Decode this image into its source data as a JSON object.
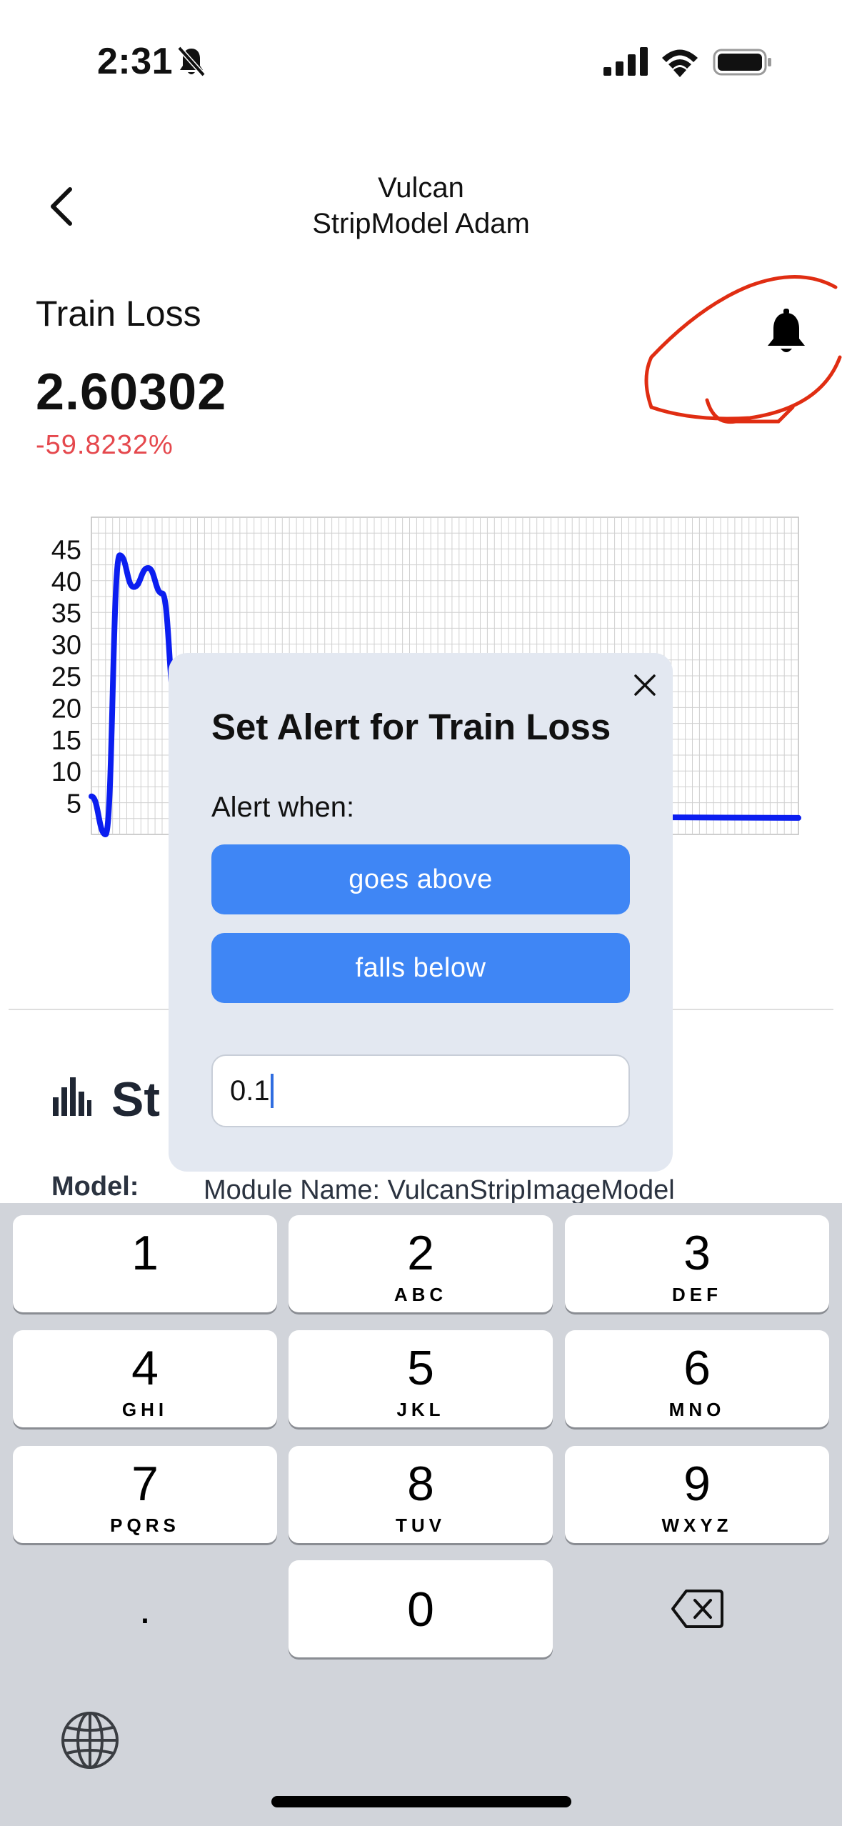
{
  "status_bar": {
    "time": "2:31"
  },
  "header": {
    "title_line1": "Vulcan",
    "title_line2": "StripModel Adam"
  },
  "metric": {
    "title": "Train Loss",
    "value": "2.60302",
    "change": "-59.8232%",
    "change_color": "#e5484d"
  },
  "chart_data": {
    "type": "line",
    "x": [
      0,
      2,
      4,
      6,
      8,
      10,
      12,
      16,
      20,
      25,
      30,
      40,
      50,
      60,
      80,
      100
    ],
    "y": [
      6,
      0,
      44,
      39,
      42,
      38,
      20,
      10,
      4,
      3,
      2.8,
      2.7,
      2.7,
      2.6,
      2.7,
      2.6
    ],
    "series": [
      {
        "name": "",
        "color": "#0b1ef0"
      }
    ],
    "y_ticks": [
      "45",
      "40",
      "35",
      "30",
      "25",
      "20",
      "15",
      "10",
      "5"
    ],
    "ylim": [
      0,
      50
    ],
    "grid": true
  },
  "stats": {
    "title": "St",
    "model_label": "Model:",
    "model_value": "Module Name: VulcanStripImageModel"
  },
  "modal": {
    "title": "Set Alert for Train Loss",
    "alert_when": "Alert when:",
    "goes_above": "goes above",
    "falls_below": "falls below",
    "threshold_value": "0.1"
  },
  "keyboard": {
    "keys": [
      {
        "num": "1",
        "letters": ""
      },
      {
        "num": "2",
        "letters": "ABC"
      },
      {
        "num": "3",
        "letters": "DEF"
      },
      {
        "num": "4",
        "letters": "GHI"
      },
      {
        "num": "5",
        "letters": "JKL"
      },
      {
        "num": "6",
        "letters": "MNO"
      },
      {
        "num": "7",
        "letters": "PQRS"
      },
      {
        "num": "8",
        "letters": "TUV"
      },
      {
        "num": "9",
        "letters": "WXYZ"
      }
    ],
    "dot": ".",
    "zero": "0"
  },
  "colors": {
    "accent": "#3f86f5",
    "annotation": "#e02d12"
  }
}
